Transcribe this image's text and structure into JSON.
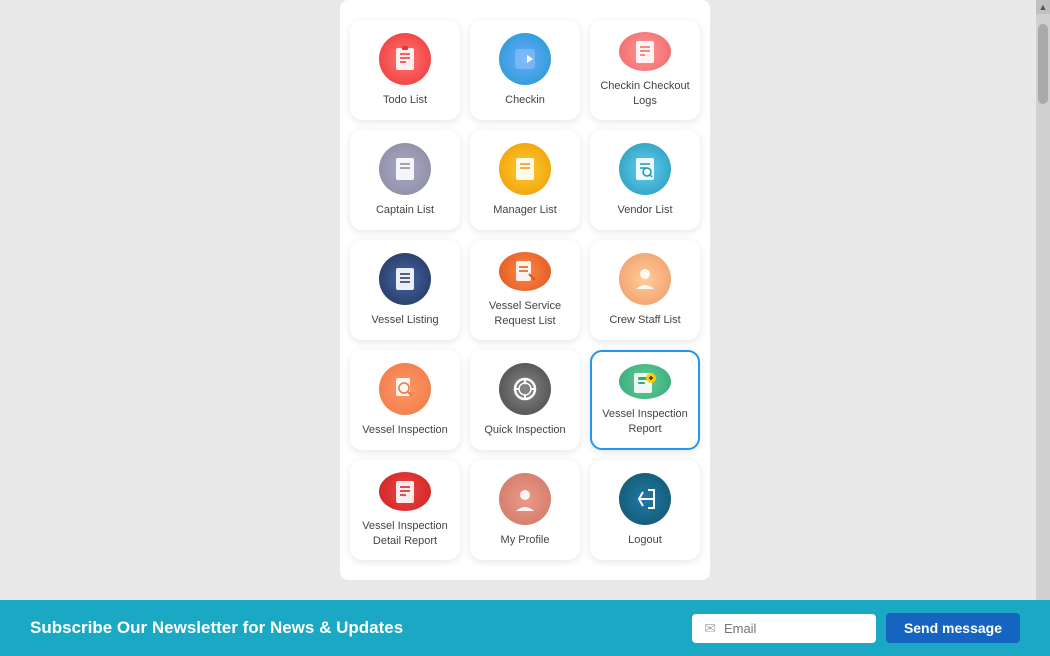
{
  "grid": {
    "items": [
      {
        "id": "todo-list",
        "label": "Todo List",
        "icon": "📋",
        "iconClass": "ic-todo",
        "selected": false
      },
      {
        "id": "checkin",
        "label": "Checkin",
        "icon": "➡️",
        "iconClass": "ic-checkin",
        "selected": false
      },
      {
        "id": "checkin-checkout-logs",
        "label": "Checkin Checkout Logs",
        "icon": "📋",
        "iconClass": "ic-checkin-logs",
        "selected": false
      },
      {
        "id": "captain-list",
        "label": "Captain List",
        "icon": "📋",
        "iconClass": "ic-captain",
        "selected": false
      },
      {
        "id": "manager-list",
        "label": "Manager List",
        "icon": "📋",
        "iconClass": "ic-manager",
        "selected": false
      },
      {
        "id": "vendor-list",
        "label": "Vendor List",
        "icon": "📋",
        "iconClass": "ic-vendor",
        "selected": false
      },
      {
        "id": "vessel-listing",
        "label": "Vessel Listing",
        "icon": "📋",
        "iconClass": "ic-vessel-listing",
        "selected": false
      },
      {
        "id": "vessel-service-request",
        "label": "Vessel Service Request List",
        "icon": "📄",
        "iconClass": "ic-vessel-service",
        "selected": false
      },
      {
        "id": "crew-staff-list",
        "label": "Crew Staff List",
        "icon": "👤",
        "iconClass": "ic-crew",
        "selected": false
      },
      {
        "id": "vessel-inspection",
        "label": "Vessel Inspection",
        "icon": "🔍",
        "iconClass": "ic-vessel-inspection",
        "selected": false
      },
      {
        "id": "quick-inspection",
        "label": "Quick Inspection",
        "icon": "⚙️",
        "iconClass": "ic-quick",
        "selected": false
      },
      {
        "id": "vessel-inspection-report",
        "label": "Vessel Inspection Report",
        "icon": "📊",
        "iconClass": "ic-report",
        "selected": true
      },
      {
        "id": "vessel-inspection-detail-report",
        "label": "Vessel Inspection Detail Report",
        "icon": "📋",
        "iconClass": "ic-detail-report",
        "selected": false
      },
      {
        "id": "my-profile",
        "label": "My Profile",
        "icon": "👤",
        "iconClass": "ic-profile",
        "selected": false
      },
      {
        "id": "logout",
        "label": "Logout",
        "icon": "🚪",
        "iconClass": "ic-logout",
        "selected": false
      }
    ]
  },
  "footer": {
    "newsletter_text": "Subscribe Our Newsletter for News & Updates",
    "email_placeholder": "Email",
    "send_label": "Send message"
  }
}
